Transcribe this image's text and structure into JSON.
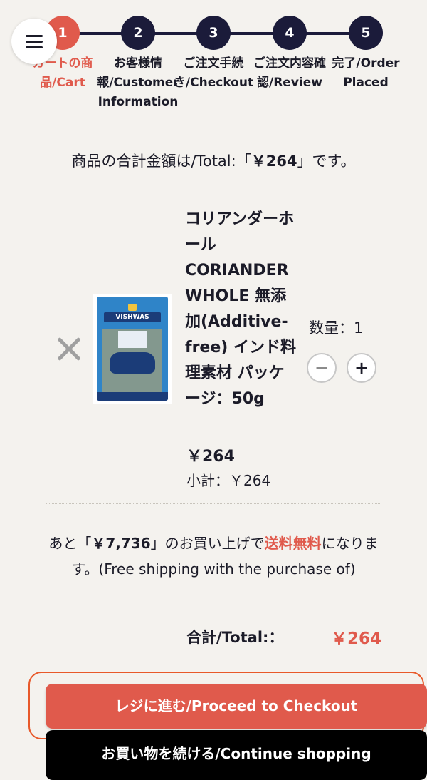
{
  "steps": [
    {
      "num": "1",
      "label": "カートの商品/Cart"
    },
    {
      "num": "2",
      "label": "お客様情報/Customer Information"
    },
    {
      "num": "3",
      "label": "ご注文手続き/Checkout"
    },
    {
      "num": "4",
      "label": "ご注文内容確認/Review"
    },
    {
      "num": "5",
      "label": "完了/Order Placed"
    }
  ],
  "summary": {
    "before": "商品の合計金額は/Total:「",
    "amount": "￥264",
    "after": "」です。"
  },
  "item": {
    "name": "コリアンダーホール CORIANDER WHOLE 無添加(Additive-free) インド料理素材 パッケージ：50g",
    "image_brand": "VISHWAS",
    "quantity_label": "数量：1",
    "minus": "−",
    "plus": "+",
    "price": "￥264",
    "subtotal": "小計：￥264"
  },
  "shipping": {
    "before": "あと「",
    "amount": "￥7,736",
    "middle": "」のお買い上げで",
    "free": "送料無料",
    "after": "になります。(Free shipping with the purchase of)"
  },
  "grand_total": {
    "label": "合計/Total:：",
    "value": "￥264"
  },
  "buttons": {
    "checkout": "レジに進む/Proceed to Checkout",
    "continue": "お買い物を続ける/Continue shopping"
  },
  "colors": {
    "accent": "#e05a4c",
    "navy": "#1b1b3a",
    "background": "#f4f2ee"
  }
}
